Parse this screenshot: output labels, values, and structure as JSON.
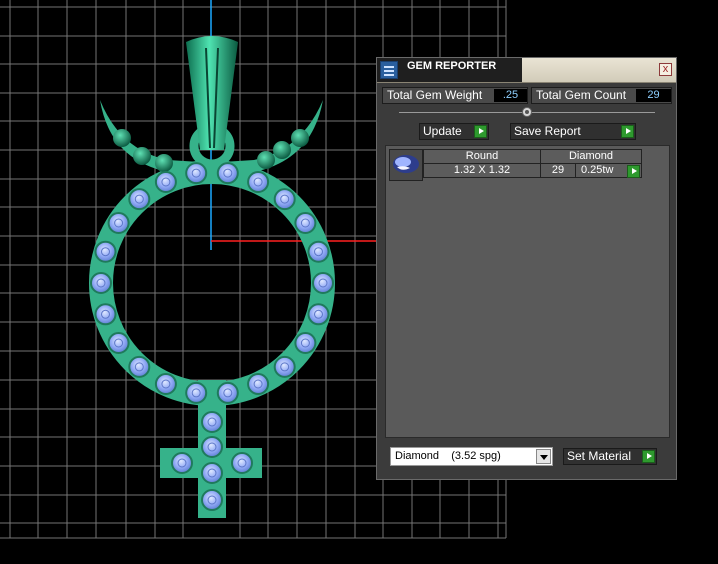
{
  "panel": {
    "title": "GEM REPORTER",
    "close_label": "x",
    "total_gem_weight_label": "Total Gem Weight",
    "total_gem_weight_value": ".25",
    "total_gem_count_label": "Total Gem Count",
    "total_gem_count_value": "29",
    "update_label": "Update",
    "save_report_label": "Save Report",
    "gem_list": {
      "columns": [
        "Round",
        "Diamond"
      ],
      "rows": [
        {
          "size": "1.32 X 1.32",
          "count": "29",
          "weight": "0.25tw"
        }
      ]
    },
    "material_select": {
      "value": "Diamond",
      "spg": "(3.52 spg)"
    },
    "set_material_label": "Set Material"
  },
  "colors": {
    "metal": "#36b28a",
    "gem": "#8ca8f4",
    "grid": "#8a8a8a",
    "axis_blue": "#1aa9ff",
    "axis_red": "#ff2020"
  }
}
